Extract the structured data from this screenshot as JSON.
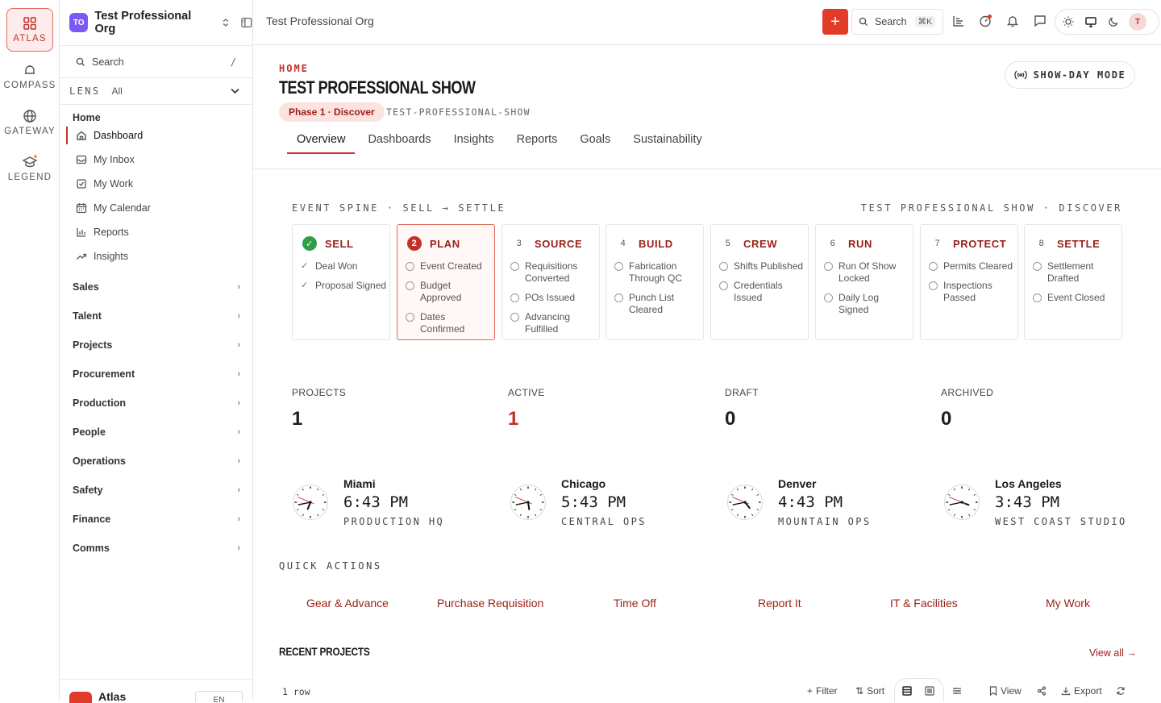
{
  "rail": {
    "items": [
      {
        "label": "ATLAS",
        "icon": "grid-icon",
        "active": true
      },
      {
        "label": "COMPASS",
        "icon": "compass-icon",
        "active": false
      },
      {
        "label": "GATEWAY",
        "icon": "globe-icon",
        "active": false
      },
      {
        "label": "LEGEND",
        "icon": "graduation-cap-icon",
        "active": false
      }
    ]
  },
  "sidebar": {
    "org_initials": "TO",
    "org_name": "Test Professional Org",
    "search_label": "Search",
    "search_shortcut": "/",
    "lens_label": "LENS",
    "lens_value": "All",
    "home_heading": "Home",
    "home_items": [
      {
        "label": "Dashboard",
        "icon": "home-icon"
      },
      {
        "label": "My Inbox",
        "icon": "inbox-icon"
      },
      {
        "label": "My Work",
        "icon": "checkbox-icon"
      },
      {
        "label": "My Calendar",
        "icon": "calendar-icon"
      },
      {
        "label": "Reports",
        "icon": "bar-chart-icon"
      },
      {
        "label": "Insights",
        "icon": "trend-icon"
      }
    ],
    "groups": [
      "Sales",
      "Talent",
      "Projects",
      "Procurement",
      "Production",
      "People",
      "Operations",
      "Safety",
      "Finance",
      "Comms"
    ],
    "footer_brand": "Atlas",
    "footer_lang": "EN"
  },
  "topbar": {
    "breadcrumb": "Test Professional Org",
    "search_label": "Search",
    "search_shortcut": "⌘K",
    "avatar_initial": "T"
  },
  "header": {
    "section": "HOME",
    "title": "TEST PROFESSIONAL SHOW",
    "phase": "Phase 1 · Discover",
    "slug": "TEST-PROFESSIONAL-SHOW",
    "show_day_button": "SHOW-DAY MODE",
    "tabs": [
      "Overview",
      "Dashboards",
      "Insights",
      "Reports",
      "Goals",
      "Sustainability"
    ]
  },
  "spine": {
    "title": "EVENT SPINE · SELL → SETTLE",
    "context": "TEST PROFESSIONAL SHOW · DISCOVER",
    "stages": [
      {
        "num": "✓",
        "name": "SELL",
        "state": "done",
        "items": [
          {
            "t": "Deal Won",
            "done": true
          },
          {
            "t": "Proposal Signed",
            "done": true
          }
        ]
      },
      {
        "num": "2",
        "name": "PLAN",
        "state": "current",
        "items": [
          {
            "t": "Event Created",
            "done": false
          },
          {
            "t": "Budget Approved",
            "done": false
          },
          {
            "t": "Dates Confirmed",
            "done": false
          }
        ]
      },
      {
        "num": "3",
        "name": "SOURCE",
        "state": "todo",
        "items": [
          {
            "t": "Requisitions Converted",
            "done": false
          },
          {
            "t": "POs Issued",
            "done": false
          },
          {
            "t": "Advancing Fulfilled",
            "done": false
          }
        ]
      },
      {
        "num": "4",
        "name": "BUILD",
        "state": "todo",
        "items": [
          {
            "t": "Fabrication Through QC",
            "done": false
          },
          {
            "t": "Punch List Cleared",
            "done": false
          }
        ]
      },
      {
        "num": "5",
        "name": "CREW",
        "state": "todo",
        "items": [
          {
            "t": "Shifts Published",
            "done": false
          },
          {
            "t": "Credentials Issued",
            "done": false
          }
        ]
      },
      {
        "num": "6",
        "name": "RUN",
        "state": "todo",
        "items": [
          {
            "t": "Run Of Show Locked",
            "done": false
          },
          {
            "t": "Daily Log Signed",
            "done": false
          }
        ]
      },
      {
        "num": "7",
        "name": "PROTECT",
        "state": "todo",
        "items": [
          {
            "t": "Permits Cleared",
            "done": false
          },
          {
            "t": "Inspections Passed",
            "done": false
          }
        ]
      },
      {
        "num": "8",
        "name": "SETTLE",
        "state": "todo",
        "items": [
          {
            "t": "Settlement Drafted",
            "done": false
          },
          {
            "t": "Event Closed",
            "done": false
          }
        ]
      }
    ]
  },
  "kpis": [
    {
      "label": "PROJECTS",
      "value": "1",
      "accent": false
    },
    {
      "label": "ACTIVE",
      "value": "1",
      "accent": true
    },
    {
      "label": "DRAFT",
      "value": "0",
      "accent": false
    },
    {
      "label": "ARCHIVED",
      "value": "0",
      "accent": false
    }
  ],
  "clocks": [
    {
      "city": "Miami",
      "time": "6:43 PM",
      "sub": "PRODUCTION HQ",
      "hour": 6,
      "minute": 43
    },
    {
      "city": "Chicago",
      "time": "5:43 PM",
      "sub": "CENTRAL OPS",
      "hour": 5,
      "minute": 43
    },
    {
      "city": "Denver",
      "time": "4:43 PM",
      "sub": "MOUNTAIN OPS",
      "hour": 4,
      "minute": 43
    },
    {
      "city": "Los Angeles",
      "time": "3:43 PM",
      "sub": "WEST COAST STUDIO",
      "hour": 3,
      "minute": 43
    }
  ],
  "quick_actions": {
    "title": "QUICK ACTIONS",
    "items": [
      "Gear & Advance",
      "Purchase Requisition",
      "Time Off",
      "Report It",
      "IT & Facilities",
      "My Work"
    ]
  },
  "recent": {
    "title": "RECENT PROJECTS",
    "view_all": "View all →",
    "row_count": "1 row",
    "toolbar": {
      "filter": "Filter",
      "sort": "Sort",
      "view": "View",
      "export": "Export"
    }
  },
  "colors": {
    "accent": "#c0322a",
    "accent_bg": "#fdeceb",
    "success": "#2f9e44",
    "org_badge": "#7a5af5",
    "primary_button": "#e23b2a"
  }
}
